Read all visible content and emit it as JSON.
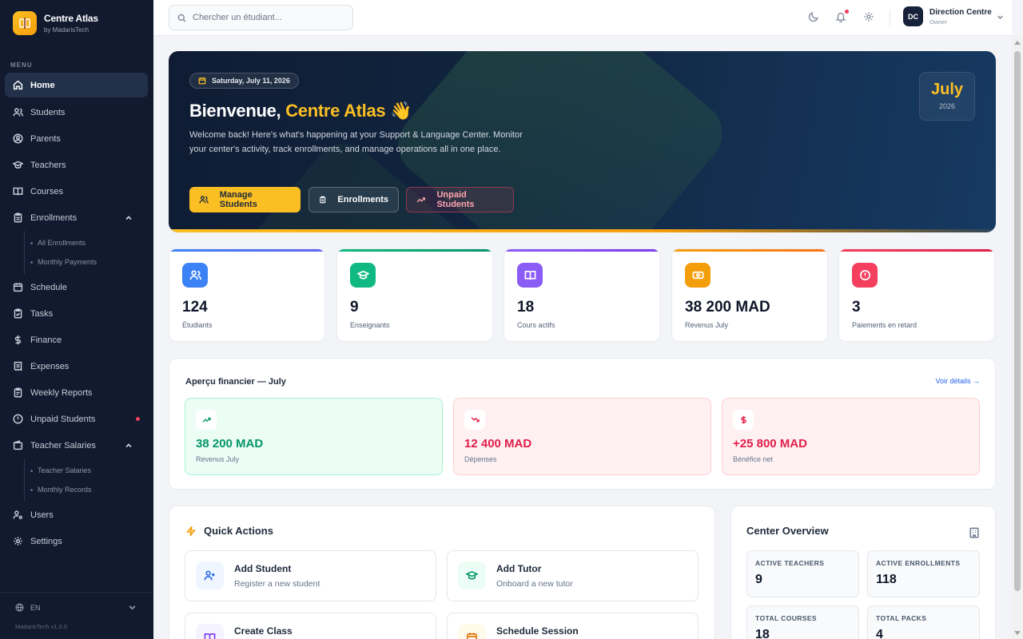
{
  "brand": {
    "name": "Centre Atlas",
    "sub": "by MadarisTech"
  },
  "sidebar": {
    "menu_label": "MENU",
    "items": [
      {
        "label": "Home"
      },
      {
        "label": "Students"
      },
      {
        "label": "Parents"
      },
      {
        "label": "Teachers"
      },
      {
        "label": "Courses"
      },
      {
        "label": "Enrollments",
        "sub": [
          "All Enrollments",
          "Monthly Payments"
        ]
      },
      {
        "label": "Schedule"
      },
      {
        "label": "Tasks"
      },
      {
        "label": "Finance"
      },
      {
        "label": "Expenses"
      },
      {
        "label": "Weekly Reports"
      },
      {
        "label": "Unpaid Students"
      },
      {
        "label": "Teacher Salaries",
        "sub": [
          "Teacher Salaries",
          "Monthly Records"
        ]
      },
      {
        "label": "Users"
      },
      {
        "label": "Settings"
      }
    ],
    "language": "EN",
    "version": "MadarisTech v1.0.0"
  },
  "topbar": {
    "search_placeholder": "Chercher un étudiant...",
    "user": {
      "initials": "DC",
      "name": "Direction Centre",
      "role": "Owner"
    }
  },
  "hero": {
    "date": "Saturday, July 11, 2026",
    "greeting": "Bienvenue,",
    "center_name": "Centre Atlas",
    "wave": "👋",
    "description": "Welcome back! Here's what's happening at your Support & Language Center. Monitor your center's activity, track enrollments, and manage operations all in one place.",
    "buttons": {
      "manage": "Manage Students",
      "enrollments": "Enrollments",
      "unpaid": "Unpaid Students"
    },
    "month": "July",
    "year": "2026"
  },
  "stats": [
    {
      "value": "124",
      "label": "Étudiants",
      "color": "#3b82f6"
    },
    {
      "value": "9",
      "label": "Enseignants",
      "color": "#10b981"
    },
    {
      "value": "18",
      "label": "Cours actifs",
      "color": "#8b5cf6"
    },
    {
      "value": "38 200 MAD",
      "label": "Revenus July",
      "color": "#f59e0b"
    },
    {
      "value": "3",
      "label": "Paiements en retard",
      "color": "#f43f5e"
    }
  ],
  "finance": {
    "title": "Aperçu financier — July",
    "link": "Voir détails →",
    "cards": [
      {
        "value": "38 200 MAD",
        "label": "Revenus July",
        "color": "#059669"
      },
      {
        "value": "12 400 MAD",
        "label": "Dépenses",
        "color": "#e11d48"
      },
      {
        "value": "+25 800 MAD",
        "label": "Bénéfice net",
        "color": "#e11d48"
      }
    ]
  },
  "quick_actions": {
    "title": "Quick Actions",
    "items": [
      {
        "name": "Add Student",
        "desc": "Register a new student"
      },
      {
        "name": "Add Tutor",
        "desc": "Onboard a new tutor"
      },
      {
        "name": "Create Class",
        "desc": ""
      },
      {
        "name": "Schedule Session",
        "desc": ""
      }
    ]
  },
  "overview": {
    "title": "Center Overview",
    "items": [
      {
        "label": "ACTIVE TEACHERS",
        "value": "9"
      },
      {
        "label": "ACTIVE ENROLLMENTS",
        "value": "118"
      },
      {
        "label": "TOTAL COURSES",
        "value": "18"
      },
      {
        "label": "TOTAL PACKS",
        "value": "4"
      }
    ]
  }
}
